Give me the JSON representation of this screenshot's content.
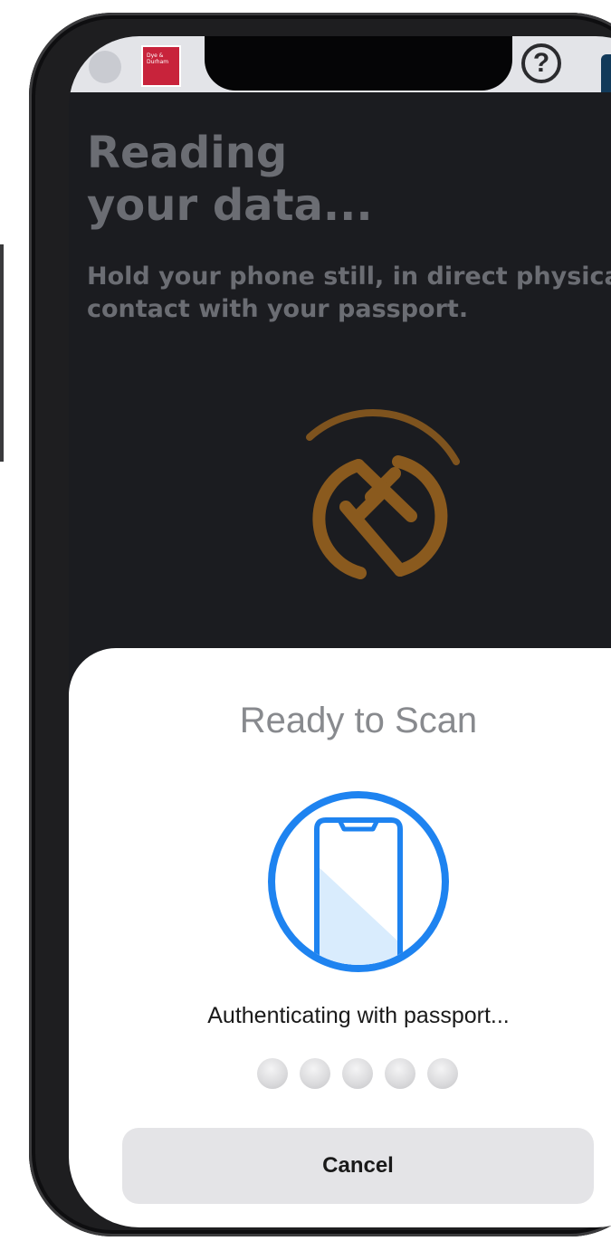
{
  "app": {
    "brand_logo_text": "Dye & Durham",
    "help_label": "?"
  },
  "main": {
    "title_line1": "Reading",
    "title_line2": "your data...",
    "subtitle_line1": "Hold your phone still, in direct physical",
    "subtitle_line2": "contact with your passport.",
    "nfc_icon": "nfc-icon",
    "accent_color": "#8a5a1e"
  },
  "scan_sheet": {
    "title": "Ready to Scan",
    "icon": "phone-scan-icon",
    "icon_color": "#1e83f0",
    "status": "Authenticating with passport...",
    "progress_dots_count": 5,
    "cancel_label": "Cancel"
  }
}
